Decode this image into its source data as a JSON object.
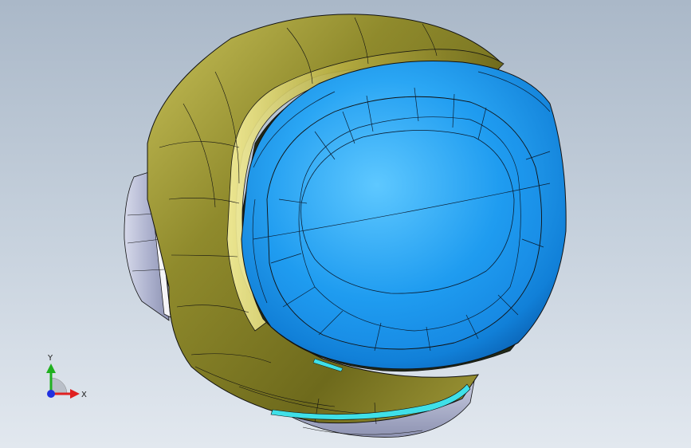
{
  "viewport": {
    "background_top": "#aab8c8",
    "background_bottom": "#e2e8ef"
  },
  "model": {
    "shell_color": "#8f8a2c",
    "visor_color": "#1e9cf0",
    "side_pod_color": "#b9bdd6",
    "accent_strip_color": "#3fe0e8",
    "edge_color": "#111111"
  },
  "triad": {
    "x_label": "X",
    "y_label": "Y",
    "x_color": "#e02020",
    "y_color": "#20b020",
    "z_color": "#2030e0"
  }
}
